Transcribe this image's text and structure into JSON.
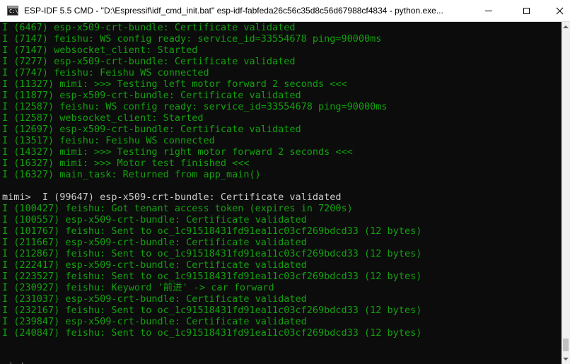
{
  "window": {
    "title": "ESP-IDF 5.5 CMD - \"D:\\Espressif\\idf_cmd_init.bat\"  esp-idf-fabfeda26c56c35d8c56d67988cf4834 - python.exe...",
    "icon": "cmd-icon",
    "buttons": {
      "minimize": "minimize-icon",
      "maximize": "maximize-icon",
      "close": "close-icon"
    }
  },
  "colors": {
    "background": "#0c0c0c",
    "log_green": "#13a10e",
    "prompt_white": "#cccccc"
  },
  "console": {
    "lines": [
      {
        "text": "I (6467) esp-x509-crt-bundle: Certificate validated",
        "kind": "log"
      },
      {
        "text": "I (7147) feishu: WS config ready: service_id=33554678 ping=90000ms",
        "kind": "log"
      },
      {
        "text": "I (7147) websocket_client: Started",
        "kind": "log"
      },
      {
        "text": "I (7277) esp-x509-crt-bundle: Certificate validated",
        "kind": "log"
      },
      {
        "text": "I (7747) feishu: Feishu WS connected",
        "kind": "log"
      },
      {
        "text": "I (11327) mimi: >>> Testing left motor forward 2 seconds <<<",
        "kind": "log"
      },
      {
        "text": "I (11877) esp-x509-crt-bundle: Certificate validated",
        "kind": "log"
      },
      {
        "text": "I (12587) feishu: WS config ready: service_id=33554678 ping=90000ms",
        "kind": "log"
      },
      {
        "text": "I (12587) websocket_client: Started",
        "kind": "log"
      },
      {
        "text": "I (12697) esp-x509-crt-bundle: Certificate validated",
        "kind": "log"
      },
      {
        "text": "I (13517) feishu: Feishu WS connected",
        "kind": "log"
      },
      {
        "text": "I (14327) mimi: >>> Testing right motor forward 2 seconds <<<",
        "kind": "log"
      },
      {
        "text": "I (16327) mimi: >>> Motor test finished <<<",
        "kind": "log"
      },
      {
        "text": "I (16327) main_task: Returned from app_main()",
        "kind": "log"
      },
      {
        "text": "",
        "kind": "blank"
      },
      {
        "text": "mimi>  I (99647) esp-x509-crt-bundle: Certificate validated",
        "kind": "prompt"
      },
      {
        "text": "I (100427) feishu: Got tenant access token (expires in 7200s)",
        "kind": "log"
      },
      {
        "text": "I (100557) esp-x509-crt-bundle: Certificate validated",
        "kind": "log"
      },
      {
        "text": "I (101767) feishu: Sent to oc_1c91518431fd91ea11c03cf269bdcd33 (12 bytes)",
        "kind": "log"
      },
      {
        "text": "I (211667) esp-x509-crt-bundle: Certificate validated",
        "kind": "log"
      },
      {
        "text": "I (212867) feishu: Sent to oc_1c91518431fd91ea11c03cf269bdcd33 (12 bytes)",
        "kind": "log"
      },
      {
        "text": "I (222417) esp-x509-crt-bundle: Certificate validated",
        "kind": "log"
      },
      {
        "text": "I (223527) feishu: Sent to oc_1c91518431fd91ea11c03cf269bdcd33 (12 bytes)",
        "kind": "log"
      },
      {
        "text": "I (230927) feishu: Keyword '前进' -> car forward",
        "kind": "log"
      },
      {
        "text": "I (231037) esp-x509-crt-bundle: Certificate validated",
        "kind": "log"
      },
      {
        "text": "I (232167) feishu: Sent to oc_1c91518431fd91ea11c03cf269bdcd33 (12 bytes)",
        "kind": "log"
      },
      {
        "text": "I (239847) esp-x509-crt-bundle: Certificate validated",
        "kind": "log"
      },
      {
        "text": "I (240847) feishu: Sent to oc_1c91518431fd91ea11c03cf269bdcd33 (12 bytes)",
        "kind": "log"
      },
      {
        "text": "",
        "kind": "blank"
      },
      {
        "text": "",
        "kind": "blank"
      },
      {
        "text": "mimi>",
        "kind": "prompt"
      }
    ]
  },
  "scrollbar": {
    "up_icon": "scroll-up-icon",
    "down_icon": "scroll-down-icon"
  }
}
